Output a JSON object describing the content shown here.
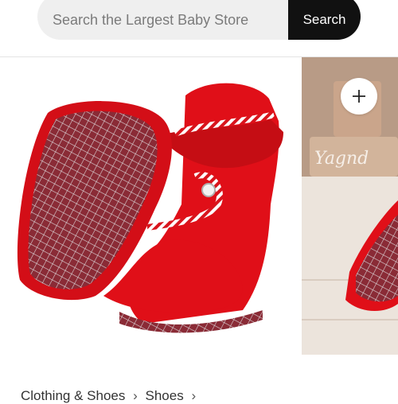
{
  "search": {
    "placeholder": "Search the Largest Baby Store",
    "value": "",
    "button_label": "Search"
  },
  "gallery": {
    "main_image": "red-fleece-baby-booties",
    "next_image": "booties-on-wooden-floor",
    "zoom_icon": "plus-icon",
    "sign_text": "Yagnd"
  },
  "breadcrumb": {
    "items": [
      "Clothing & Shoes",
      "Shoes"
    ],
    "separator": "›"
  },
  "colors": {
    "accent": "#111111",
    "product_red": "#e00f18",
    "search_bg": "#efefef"
  }
}
